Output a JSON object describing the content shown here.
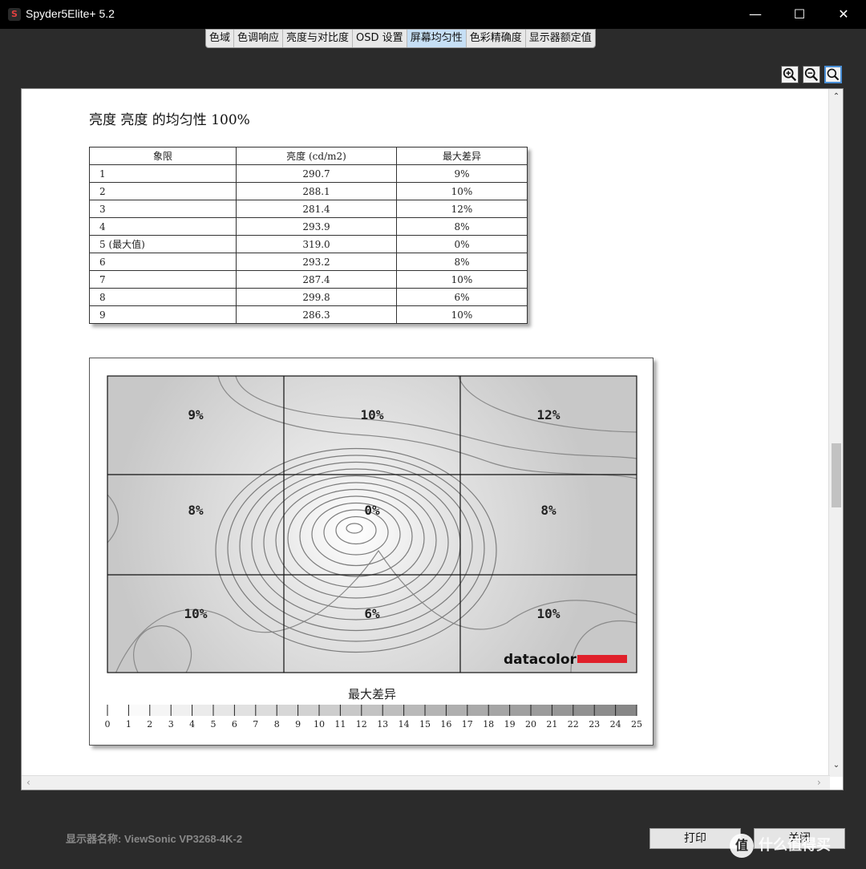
{
  "window": {
    "title": "Spyder5Elite+ 5.2",
    "app_icon": "S",
    "min_icon": "—",
    "max_icon": "☐",
    "close_icon": "✕"
  },
  "tabs": [
    {
      "label": "色域",
      "active": false
    },
    {
      "label": "色调响应",
      "active": false
    },
    {
      "label": "亮度与对比度",
      "active": false
    },
    {
      "label": "OSD 设置",
      "active": false
    },
    {
      "label": "屏幕均匀性",
      "active": true
    },
    {
      "label": "色彩精确度",
      "active": false
    },
    {
      "label": "显示器额定值",
      "active": false
    }
  ],
  "zoom": {
    "icons": [
      "zoom-in-icon",
      "zoom-out-icon",
      "zoom-fit-icon"
    ]
  },
  "report": {
    "title": "亮度 亮度 的均匀性 100%",
    "table": {
      "headers": [
        "象限",
        "亮度 (cd/m2)",
        "最大差异"
      ],
      "rows": [
        [
          "1",
          "290.7",
          "9%"
        ],
        [
          "2",
          "288.1",
          "10%"
        ],
        [
          "3",
          "281.4",
          "12%"
        ],
        [
          "4",
          "293.9",
          "8%"
        ],
        [
          "5 (最大值)",
          "319.0",
          "0%"
        ],
        [
          "6",
          "293.2",
          "8%"
        ],
        [
          "7",
          "287.4",
          "10%"
        ],
        [
          "8",
          "299.8",
          "6%"
        ],
        [
          "9",
          "286.3",
          "10%"
        ]
      ]
    }
  },
  "chart_data": {
    "type": "heatmap",
    "grid_rows": 3,
    "grid_cols": 3,
    "cell_labels": [
      "9%",
      "10%",
      "12%",
      "8%",
      "0%",
      "8%",
      "10%",
      "6%",
      "10%"
    ],
    "values": [
      [
        9,
        10,
        12
      ],
      [
        8,
        0,
        8
      ],
      [
        10,
        6,
        10
      ]
    ],
    "colorbar_title": "最大差异",
    "colorbar_ticks": [
      "0",
      "1",
      "2",
      "3",
      "4",
      "5",
      "6",
      "7",
      "8",
      "9",
      "10",
      "11",
      "12",
      "13",
      "14",
      "15",
      "16",
      "17",
      "18",
      "19",
      "20",
      "21",
      "22",
      "23",
      "24",
      "25"
    ],
    "colorbar_range": [
      0,
      25
    ],
    "logo_text": "datacolor",
    "logo_color": "#e0202a"
  },
  "footer": {
    "monitor_label": "显示器名称: ViewSonic VP3268-4K-2",
    "print_label": "打印",
    "close_label": "关闭",
    "watermark": "什么值得买",
    "watermark_badge": "值"
  },
  "colors": {
    "titlebar": "#000000",
    "active_tab": "#c6dff5",
    "background": "#2b2b2b"
  }
}
